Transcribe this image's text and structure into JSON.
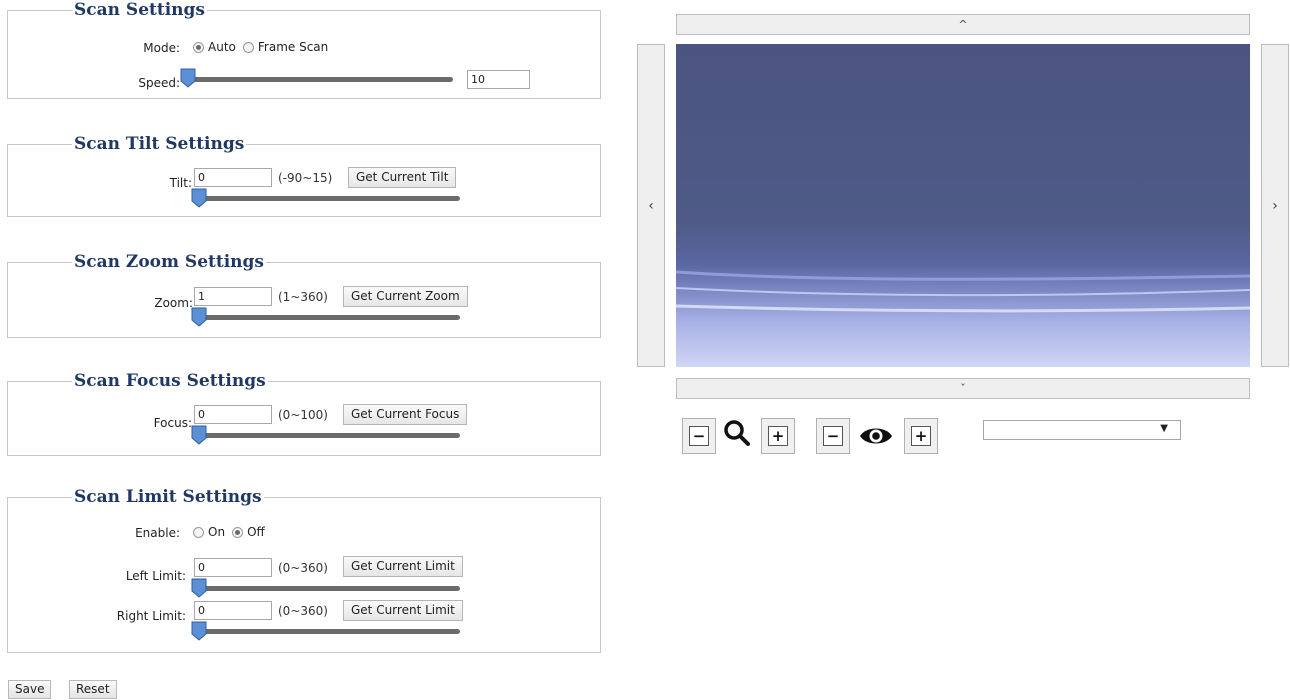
{
  "scan_settings": {
    "title": "Scan Settings",
    "mode_label": "Mode:",
    "mode_options": [
      "Auto",
      "Frame Scan"
    ],
    "mode_selected": "Auto",
    "speed_label": "Speed:",
    "speed_value": "10"
  },
  "tilt_settings": {
    "title": "Scan Tilt Settings",
    "tilt_label": "Tilt:",
    "tilt_value": "0",
    "range": "(-90~15)",
    "button": "Get Current Tilt"
  },
  "zoom_settings": {
    "title": "Scan Zoom Settings",
    "zoom_label": "Zoom:",
    "zoom_value": "1",
    "range": "(1~360)",
    "button": "Get Current Zoom"
  },
  "focus_settings": {
    "title": "Scan Focus Settings",
    "focus_label": "Focus:",
    "focus_value": "0",
    "range": "(0~100)",
    "button": "Get Current Focus"
  },
  "limit_settings": {
    "title": "Scan Limit Settings",
    "enable_label": "Enable:",
    "enable_options": [
      "On",
      "Off"
    ],
    "enable_selected": "Off",
    "left_label": "Left Limit:",
    "left_value": "0",
    "left_range": "(0~360)",
    "left_button": "Get Current Limit",
    "right_label": "Right Limit:",
    "right_value": "0",
    "right_range": "(0~360)",
    "right_button": "Get Current Limit"
  },
  "footer": {
    "save": "Save",
    "reset": "Reset"
  },
  "ptz": {
    "up_glyph": "^",
    "down_glyph": "ˇ",
    "left_glyph": "‹",
    "right_glyph": "›",
    "zoom_out_glyph": "−",
    "zoom_in_glyph": "+",
    "iris_close_glyph": "−",
    "iris_open_glyph": "+",
    "preset_select_value": ""
  },
  "icons": {
    "zoom": "magnifier-icon",
    "iris": "eye-icon"
  },
  "colors": {
    "panel_title": "#1f3864",
    "slider_thumb": "#5b8fd6",
    "video_top": "#4b5480",
    "video_bottom": "#d0d6f5"
  }
}
